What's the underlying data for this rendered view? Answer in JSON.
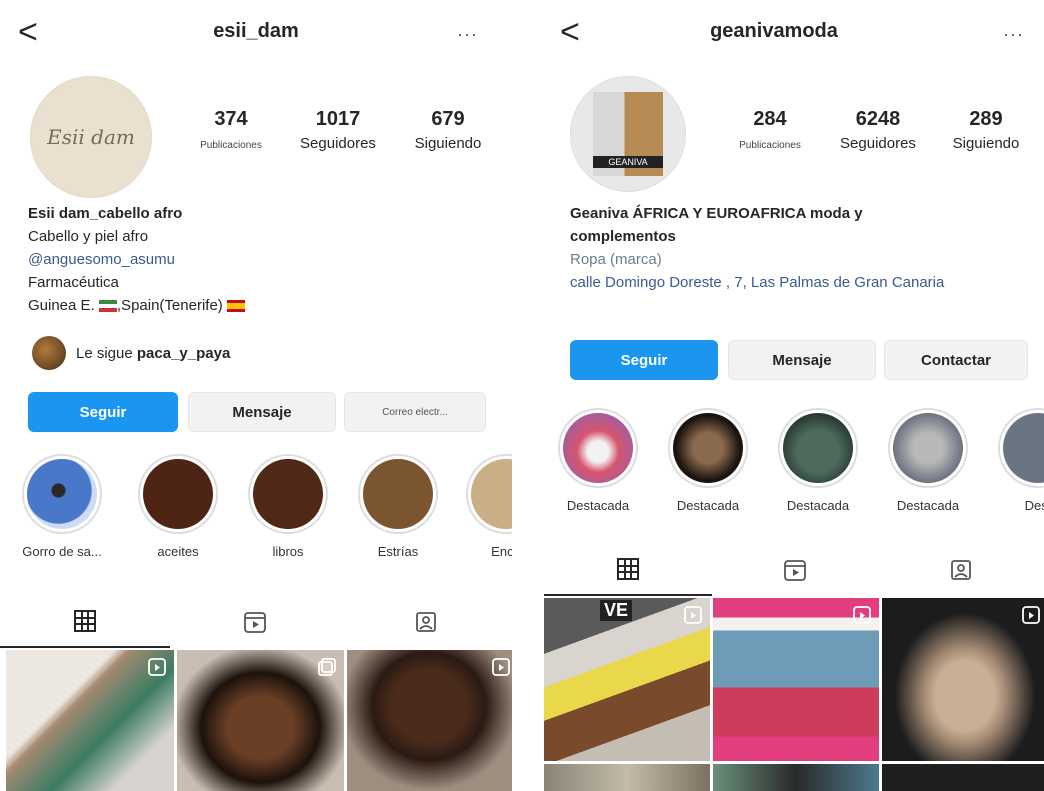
{
  "left": {
    "username": "esii_dam",
    "back_label": "<",
    "more_label": "···",
    "avatar_text": "Esii dam",
    "stats": [
      {
        "num": "374",
        "label": "Publicaciones"
      },
      {
        "num": "1017",
        "label": "Seguidores"
      },
      {
        "num": "679",
        "label": "Siguiendo"
      }
    ],
    "bio": {
      "name": "Esii dam_cabello afro",
      "line1": "Cabello y piel afro",
      "mention": "@anguesomo_asumu",
      "line3": "Farmacéutica",
      "line4": "Guinea E. ",
      "line4b": ",Spain(Tenerife)"
    },
    "followed_by_prefix": "Le sigue ",
    "followed_by_user": "paca_y_paya",
    "buttons": {
      "follow": "Seguir",
      "message": "Mensaje",
      "email": "Correo electr..."
    },
    "highlights": [
      "Gorro de sa...",
      "aceites",
      "libros",
      "Estrías",
      "Encu"
    ]
  },
  "right": {
    "username": "geanivamoda",
    "back_label": "<",
    "more_label": "···",
    "avatar_text": "GEANIVA",
    "stats": [
      {
        "num": "284",
        "label": "Publicaciones"
      },
      {
        "num": "6248",
        "label": "Seguidores"
      },
      {
        "num": "289",
        "label": "Siguiendo"
      }
    ],
    "bio": {
      "name": "Geaniva ÁFRICA Y EUROAFRICA moda y complementos",
      "category": "Ropa (marca)",
      "address": "calle Domingo Doreste , 7, Las Palmas de Gran Canaria"
    },
    "buttons": {
      "follow": "Seguir",
      "message": "Mensaje",
      "contact": "Contactar"
    },
    "highlights": [
      "Destacada",
      "Destacada",
      "Destacada",
      "Destacada",
      "Dest"
    ],
    "tile_text": "VE"
  },
  "colors": {
    "accent": "#1a95f0",
    "text": "#262626",
    "link": "#3b5b8f"
  }
}
